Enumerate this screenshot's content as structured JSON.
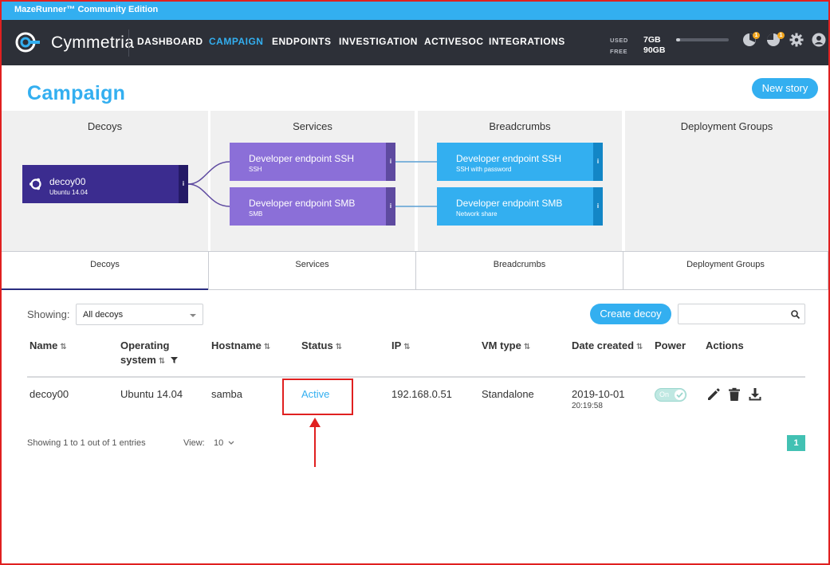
{
  "window": {
    "title": "MazeRunner™ Community Edition"
  },
  "nav": {
    "logo_text": "Cymmetria",
    "items": [
      {
        "label": "DASHBOARD",
        "active": false
      },
      {
        "label": "CAMPAIGN",
        "active": true
      },
      {
        "label": "ENDPOINTS",
        "active": false
      },
      {
        "label": "INVESTIGATION",
        "active": false
      },
      {
        "label": "ACTIVESOC",
        "active": false
      },
      {
        "label": "INTEGRATIONS",
        "active": false
      }
    ],
    "memory": {
      "used_label": "USED",
      "used_value": "7GB",
      "free_label": "FREE",
      "free_value": "90GB",
      "used_fraction": 0.07
    },
    "badges": {
      "alerts": "1",
      "notifications": "1"
    }
  },
  "page": {
    "title": "Campaign",
    "new_story_button": "New story"
  },
  "story": {
    "columns": [
      "Decoys",
      "Services",
      "Breadcrumbs",
      "Deployment Groups"
    ],
    "decoy": {
      "name": "decoy00",
      "os": "Ubuntu 14.04"
    },
    "services": [
      {
        "title": "Developer endpoint SSH",
        "sub": "SSH"
      },
      {
        "title": "Developer endpoint SMB",
        "sub": "SMB"
      }
    ],
    "breadcrumbs": [
      {
        "title": "Developer endpoint SSH",
        "sub": "SSH with password"
      },
      {
        "title": "Developer endpoint SMB",
        "sub": "Network share"
      }
    ],
    "info_glyph": "i"
  },
  "tabs": [
    {
      "label": "Decoys",
      "active": true
    },
    {
      "label": "Services",
      "active": false
    },
    {
      "label": "Breadcrumbs",
      "active": false
    },
    {
      "label": "Deployment Groups",
      "active": false
    }
  ],
  "toolbar": {
    "showing_label": "Showing:",
    "filter_value": "All decoys",
    "create_button": "Create decoy",
    "search_placeholder": ""
  },
  "table": {
    "headers": {
      "name": "Name",
      "os_line1": "Operating",
      "os_line2": "system",
      "hostname": "Hostname",
      "status": "Status",
      "ip": "IP",
      "vm_type": "VM type",
      "date_created": "Date created",
      "power": "Power",
      "actions": "Actions"
    },
    "sort_glyph": "⇅",
    "rows": [
      {
        "name": "decoy00",
        "os": "Ubuntu 14.04",
        "hostname": "samba",
        "status": "Active",
        "ip": "192.168.0.51",
        "vm_type": "Standalone",
        "date": "2019-10-01",
        "time": "20:19:58",
        "power": "On"
      }
    ]
  },
  "footer": {
    "entries_text": "Showing 1 to 1 out of 1 entries",
    "view_label": "View:",
    "view_value": "10",
    "page": "1"
  },
  "colors": {
    "accent": "#33aff0",
    "decoy_card": "#3b2c8f",
    "service_card": "#8b6fd8",
    "breadcrumb_card": "#33aff0",
    "navbar": "#2d3038",
    "annotation": "#e02020",
    "pager": "#42c1b3"
  }
}
